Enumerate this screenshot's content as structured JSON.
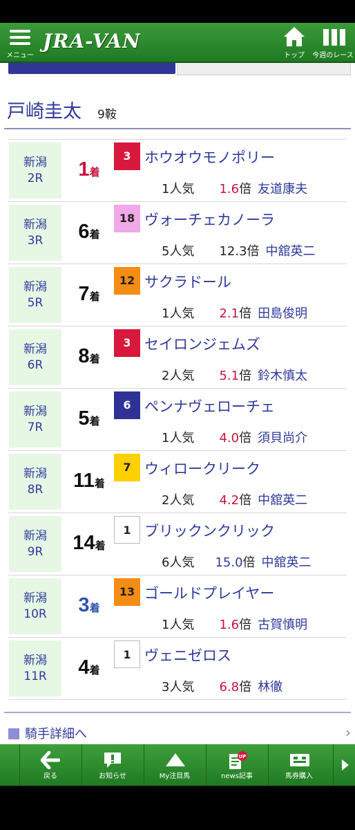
{
  "header": {
    "logo": "JRA-VAN",
    "menu_label": "メニュー",
    "top_label": "トップ",
    "week_label": "今週のレース"
  },
  "jockey": {
    "name": "戸崎圭太",
    "rides": "9鞍"
  },
  "results": [
    {
      "venue": "新潟",
      "race": "2R",
      "place": "1",
      "place_unit": "着",
      "gate": "3",
      "gate_color": "#d8183c",
      "gate_text": "#ffffff",
      "horse": "ホウオウモノポリー",
      "popularity": "1人気",
      "odds": "1.6",
      "odds_unit": "倍",
      "rider": "友道康夫"
    },
    {
      "venue": "新潟",
      "race": "3R",
      "place": "6",
      "place_unit": "着",
      "gate": "18",
      "gate_color": "#f0a8e6",
      "gate_text": "#222222",
      "horse": "ヴォーチェカノーラ",
      "popularity": "5人気",
      "odds": "12.3",
      "odds_unit": "倍",
      "rider": "中舘英二"
    },
    {
      "venue": "新潟",
      "race": "5R",
      "place": "7",
      "place_unit": "着",
      "gate": "12",
      "gate_color": "#f58c14",
      "gate_text": "#222222",
      "horse": "サクラドール",
      "popularity": "1人気",
      "odds": "2.1",
      "odds_unit": "倍",
      "rider": "田島俊明"
    },
    {
      "venue": "新潟",
      "race": "6R",
      "place": "8",
      "place_unit": "着",
      "gate": "3",
      "gate_color": "#d8183c",
      "gate_text": "#ffffff",
      "horse": "セイロンジェムズ",
      "popularity": "2人気",
      "odds": "5.1",
      "odds_unit": "倍",
      "rider": "鈴木慎太"
    },
    {
      "venue": "新潟",
      "race": "7R",
      "place": "5",
      "place_unit": "着",
      "gate": "6",
      "gate_color": "#2e3296",
      "gate_text": "#ffffff",
      "horse": "ペンナヴェローチェ",
      "popularity": "1人気",
      "odds": "4.0",
      "odds_unit": "倍",
      "rider": "須貝尚介"
    },
    {
      "venue": "新潟",
      "race": "8R",
      "place": "11",
      "place_unit": "着",
      "gate": "7",
      "gate_color": "#ffd000",
      "gate_text": "#222222",
      "horse": "ウィロークリーク",
      "popularity": "2人気",
      "odds": "4.2",
      "odds_unit": "倍",
      "rider": "中舘英二"
    },
    {
      "venue": "新潟",
      "race": "9R",
      "place": "14",
      "place_unit": "着",
      "gate": "1",
      "gate_color": "#ffffff",
      "gate_text": "#222222",
      "horse": "ブリックンクリック",
      "popularity": "6人気",
      "odds": "15.0",
      "odds_unit": "倍",
      "rider": "中舘英二"
    },
    {
      "venue": "新潟",
      "race": "10R",
      "place": "3",
      "place_unit": "着",
      "gate": "13",
      "gate_color": "#f58c14",
      "gate_text": "#222222",
      "horse": "ゴールドプレイヤー",
      "popularity": "1人気",
      "odds": "1.6",
      "odds_unit": "倍",
      "rider": "古賀慎明"
    },
    {
      "venue": "新潟",
      "race": "11R",
      "place": "4",
      "place_unit": "着",
      "gate": "1",
      "gate_color": "#ffffff",
      "gate_text": "#222222",
      "horse": "ヴェニゼロス",
      "popularity": "3人気",
      "odds": "6.8",
      "odds_unit": "倍",
      "rider": "林徹"
    }
  ],
  "detail_link": "騎手詳細へ",
  "footer": {
    "back": "戻る",
    "news": "お知らせ",
    "my_horse": "My注目馬",
    "articles": "news記事",
    "tickets": "馬券購入",
    "up_badge": "UP"
  }
}
